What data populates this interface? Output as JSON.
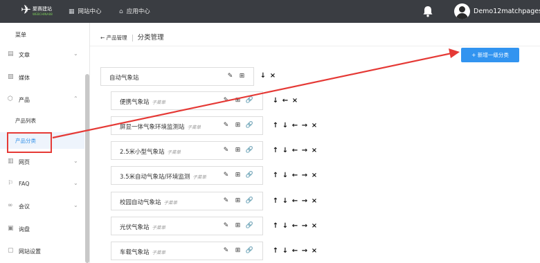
{
  "topbar": {
    "logo_name": "聚赛建站",
    "logo_sub": "WEBCHINA88",
    "nav": [
      {
        "label": "网站中心",
        "icon": "grid-icon"
      },
      {
        "label": "应用中心",
        "icon": "house-icon"
      }
    ],
    "username": "Demo12matchpages"
  },
  "sidebar": {
    "title": "菜单",
    "items": [
      {
        "label": "文章",
        "icon": "article-icon"
      },
      {
        "label": "媒体",
        "icon": "media-icon"
      },
      {
        "label": "产品",
        "icon": "product-icon"
      },
      {
        "label": "产品列表"
      },
      {
        "label": "产品分类"
      },
      {
        "label": "网页",
        "icon": "page-icon"
      },
      {
        "label": "FAQ",
        "icon": "faq-icon"
      },
      {
        "label": "会议",
        "icon": "meeting-icon"
      },
      {
        "label": "询盘",
        "icon": "inquiry-icon"
      },
      {
        "label": "网站设置",
        "icon": "settings-icon"
      }
    ]
  },
  "header": {
    "back_label": "← 产品管理",
    "title": "分类管理"
  },
  "add_button_label": "+ 新增一级分类",
  "root_category": {
    "name": "自动气象站"
  },
  "sub_tag": "子菜单",
  "categories": [
    {
      "name": "便携气象站"
    },
    {
      "name": "屏显一体气象环境监测站"
    },
    {
      "name": "2.5米小型气象站"
    },
    {
      "name": "3.5米自动气象站/环境监测"
    },
    {
      "name": "校园自动气象站"
    },
    {
      "name": "光伏气象站"
    },
    {
      "name": "车载气象站"
    }
  ],
  "annotation_color": "#e53935",
  "accent_color": "#3294f0"
}
